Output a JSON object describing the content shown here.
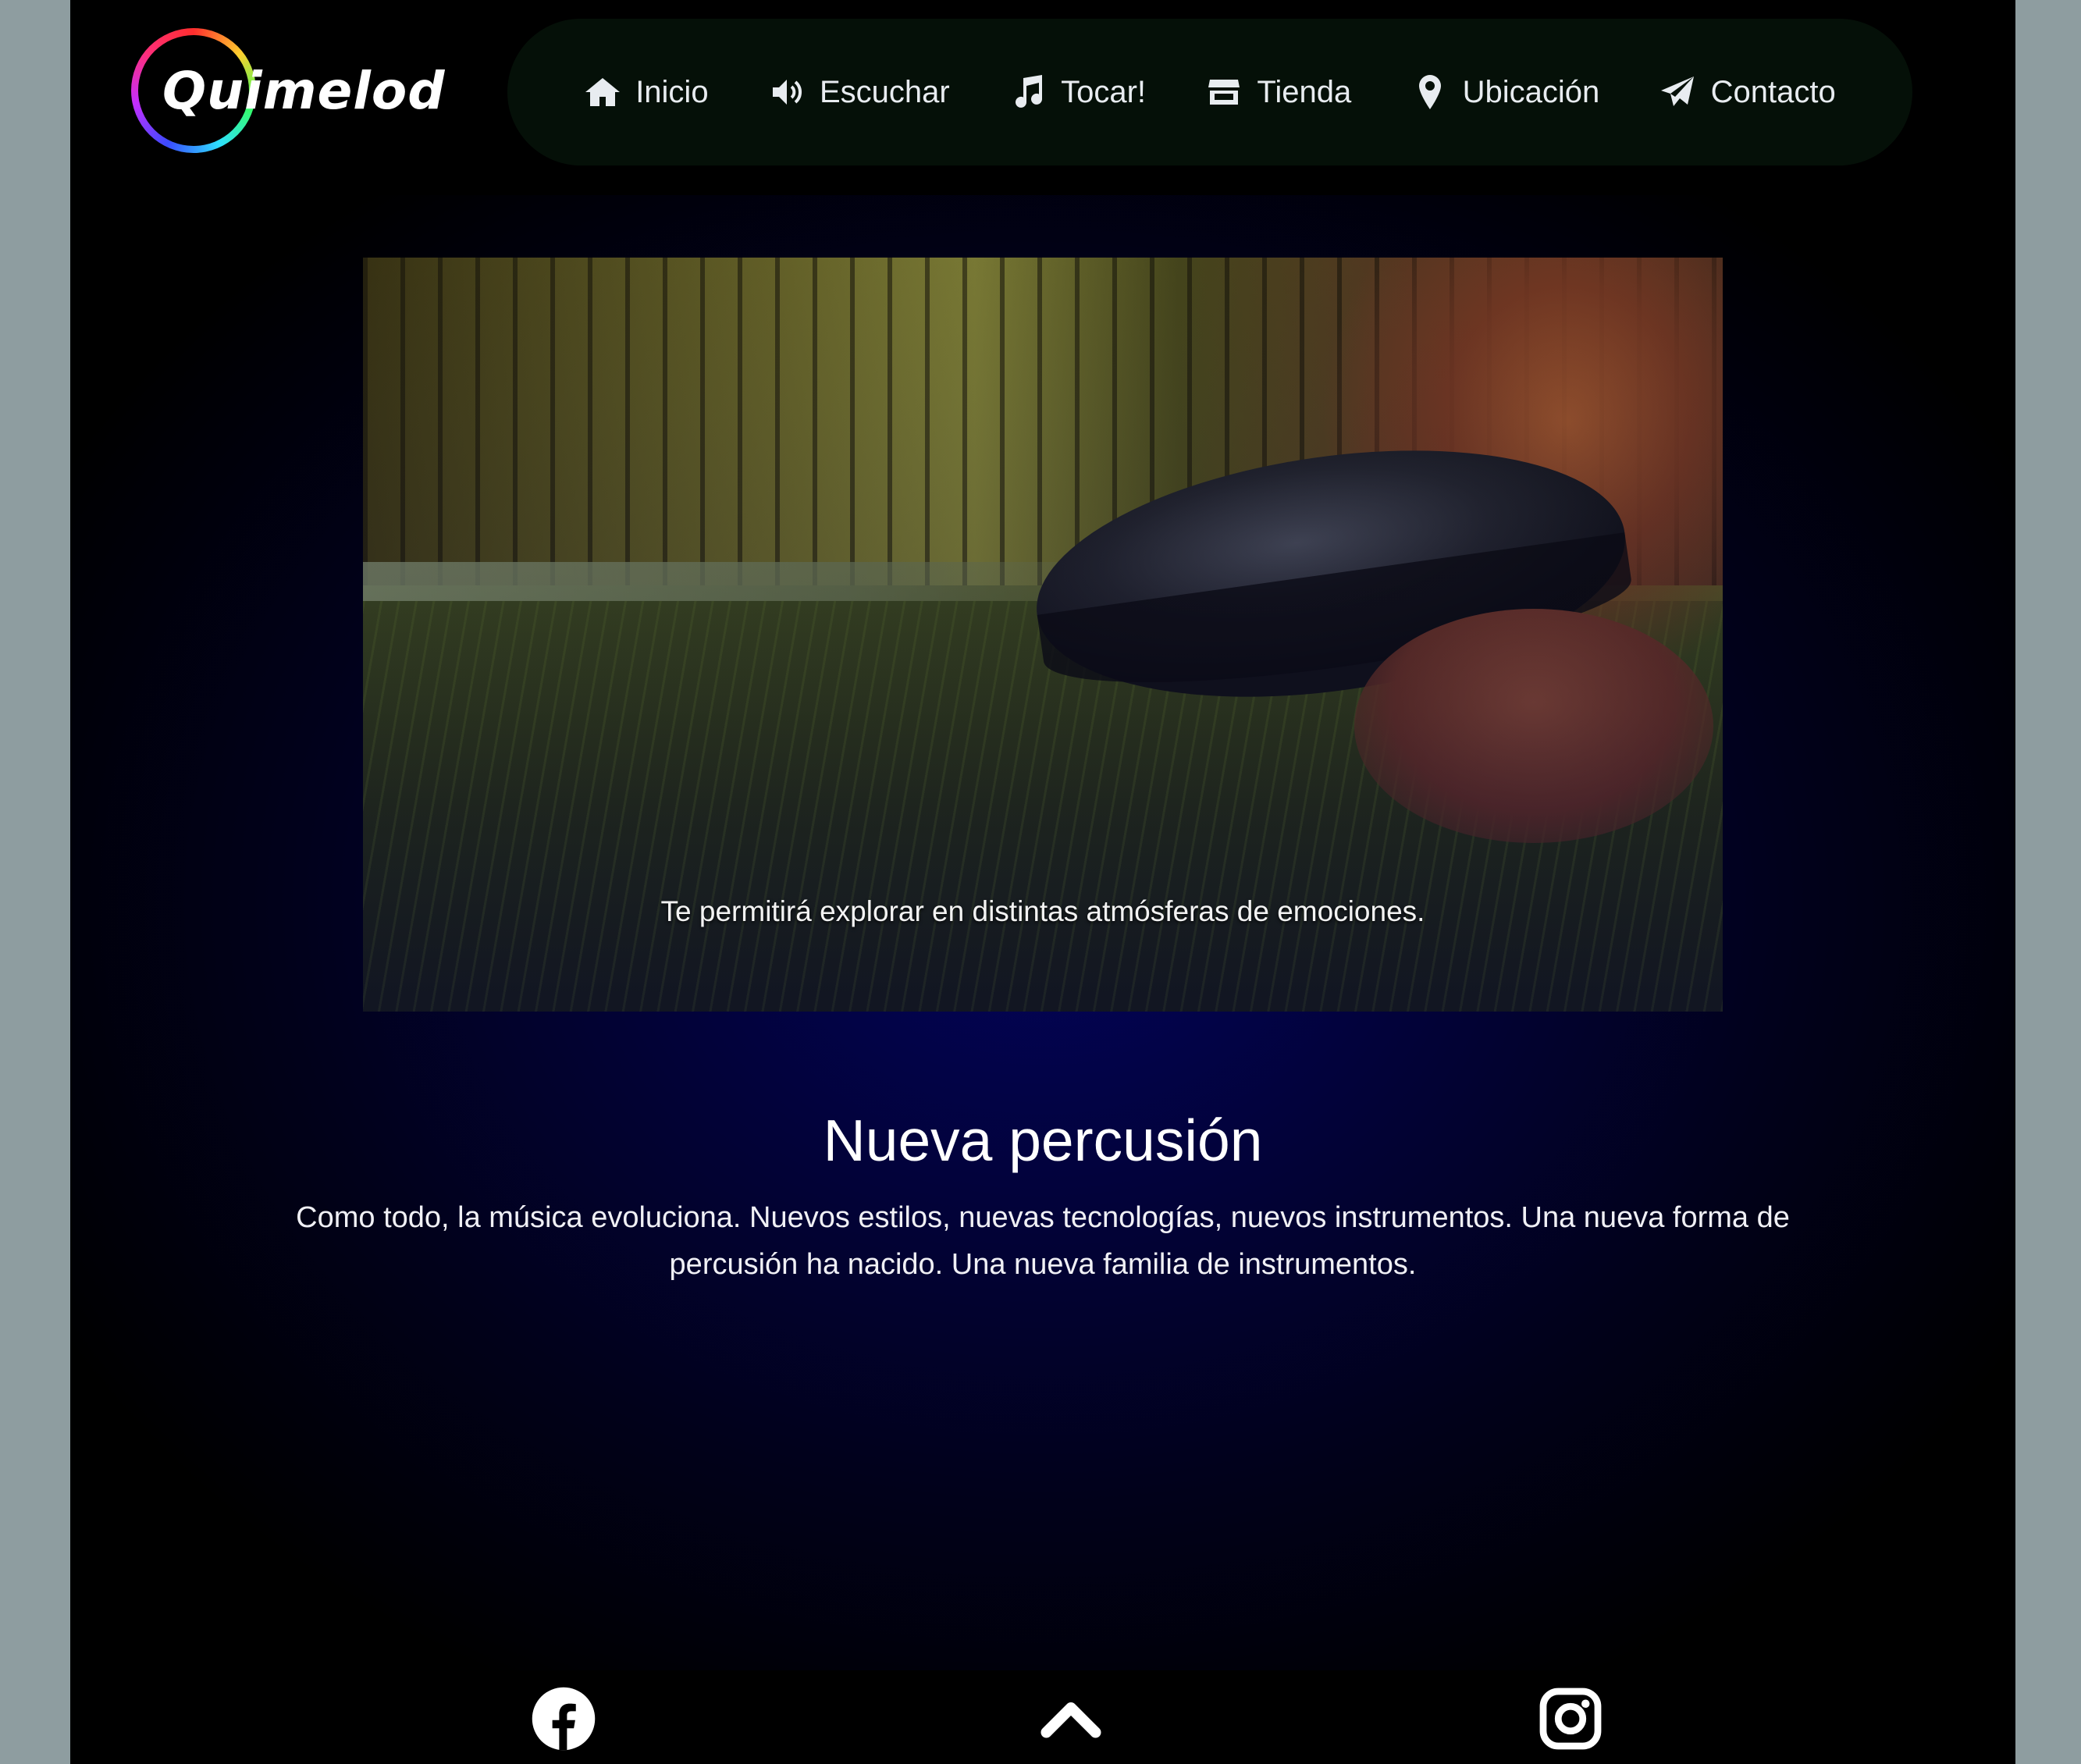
{
  "brand": {
    "logo_text": "Quimelod"
  },
  "nav": {
    "items": [
      {
        "label": "Inicio",
        "icon": "home-icon"
      },
      {
        "label": "Escuchar",
        "icon": "speaker-icon"
      },
      {
        "label": "Tocar!",
        "icon": "music-note-icon"
      },
      {
        "label": "Tienda",
        "icon": "store-icon"
      },
      {
        "label": "Ubicación",
        "icon": "map-pin-icon"
      },
      {
        "label": "Contacto",
        "icon": "paper-plane-icon"
      }
    ]
  },
  "hero": {
    "caption": "Te permitirá explorar en distintas atmósferas de emociones."
  },
  "content": {
    "heading": "Nueva percusión",
    "paragraph": "Como todo, la música evoluciona. Nuevos estilos, nuevas tecnologías, nuevos instrumentos. Una nueva forma de percusión ha nacido. Una nueva familia de instrumentos."
  },
  "footer": {
    "icons": [
      "facebook-icon",
      "chevron-up-icon",
      "instagram-icon"
    ]
  },
  "colors": {
    "background_side": "#8e9da0",
    "page": "#000000",
    "nav_pill": "#051008",
    "glow": "#03045a",
    "text": "#ffffff"
  }
}
